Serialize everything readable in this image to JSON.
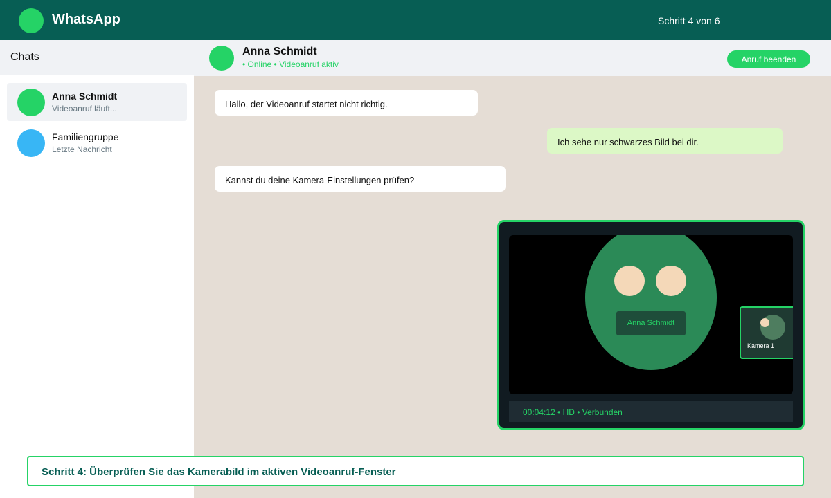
{
  "app": {
    "title": "WhatsApp",
    "step_counter": "Schritt 4 von 6"
  },
  "colors": {
    "brand_dark": "#075e54",
    "accent": "#25d366",
    "bubble_out": "#dcf8c6",
    "chat_bg": "#e5ddd5"
  },
  "sidebar": {
    "header": "Chats",
    "items": [
      {
        "name": "Anna Schmidt",
        "preview": "Videoanruf läuft...",
        "active": true,
        "avatar_color": "#25d366"
      },
      {
        "name": "Familiengruppe",
        "preview": "Letzte Nachricht",
        "active": false,
        "avatar_color": "#38b6f5"
      }
    ]
  },
  "chat_header": {
    "name": "Anna Schmidt",
    "status": "• Online • Videoanruf aktiv",
    "end_call_label": "Anruf beenden"
  },
  "messages": [
    {
      "text": "Hallo, der Videoanruf startet nicht richtig.",
      "direction": "in"
    },
    {
      "text": "Ich sehe nur schwarzes Bild bei dir.",
      "direction": "out"
    },
    {
      "text": "Kannst du deine Kamera-Einstellungen prüfen?",
      "direction": "in"
    }
  ],
  "video_call": {
    "caller_name": "Anna Schmidt",
    "pip_label": "Kamera 1",
    "status": "00:04:12 • HD • Verbunden"
  },
  "instruction": "Schritt 4: Überprüfen Sie das Kamerabild im aktiven Videoanruf-Fenster"
}
